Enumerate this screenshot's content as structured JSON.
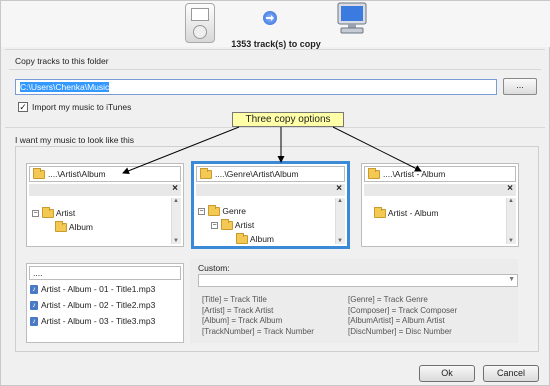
{
  "header": {
    "track_count": "1353 track(s) to copy",
    "icons": [
      "ipod-icon",
      "arrow-right-icon",
      "computer-icon"
    ]
  },
  "copy_folder": {
    "section_label": "Copy tracks to this folder",
    "path_value": "C:\\Users\\Chenka\\Music",
    "browse_label": "...",
    "import_checkbox_checked": true,
    "import_label": "Import my music to iTunes"
  },
  "look": {
    "section_label": "I want my music to look like this",
    "callout": "Three copy options"
  },
  "options": [
    {
      "path": "....\\Artist\\Album",
      "close": "×",
      "tree": [
        "Artist",
        "Album"
      ]
    },
    {
      "path": "....\\Genre\\Artist\\Album",
      "close": "×",
      "tree": [
        "Genre",
        "Artist",
        "Album"
      ]
    },
    {
      "path": "....\\Artist - Album",
      "close": "×",
      "tree": [
        "Artist - Album"
      ]
    }
  ],
  "mp3_preview": {
    "top": "....",
    "files": [
      "Artist - Album - 01 - Title1.mp3",
      "Artist - Album - 02 - Title2.mp3",
      "Artist - Album - 03 - Title3.mp3"
    ]
  },
  "custom": {
    "label": "Custom:",
    "value": "",
    "legend_left": [
      "[Title] = Track Title",
      "[Artist] = Track Artist",
      "[Album] = Track Album",
      "[TrackNumber] = Track Number"
    ],
    "legend_right": [
      "[Genre] = Track Genre",
      "[Composer] = Track Composer",
      "[AlbumArtist] = Album Artist",
      "[DiscNumber] = Disc Number"
    ]
  },
  "buttons": {
    "ok": "Ok",
    "cancel": "Cancel"
  },
  "colors": {
    "selected_border": "#3a8ad8",
    "callout_bg": "#ffffa8",
    "selection_highlight": "#3399ff"
  }
}
